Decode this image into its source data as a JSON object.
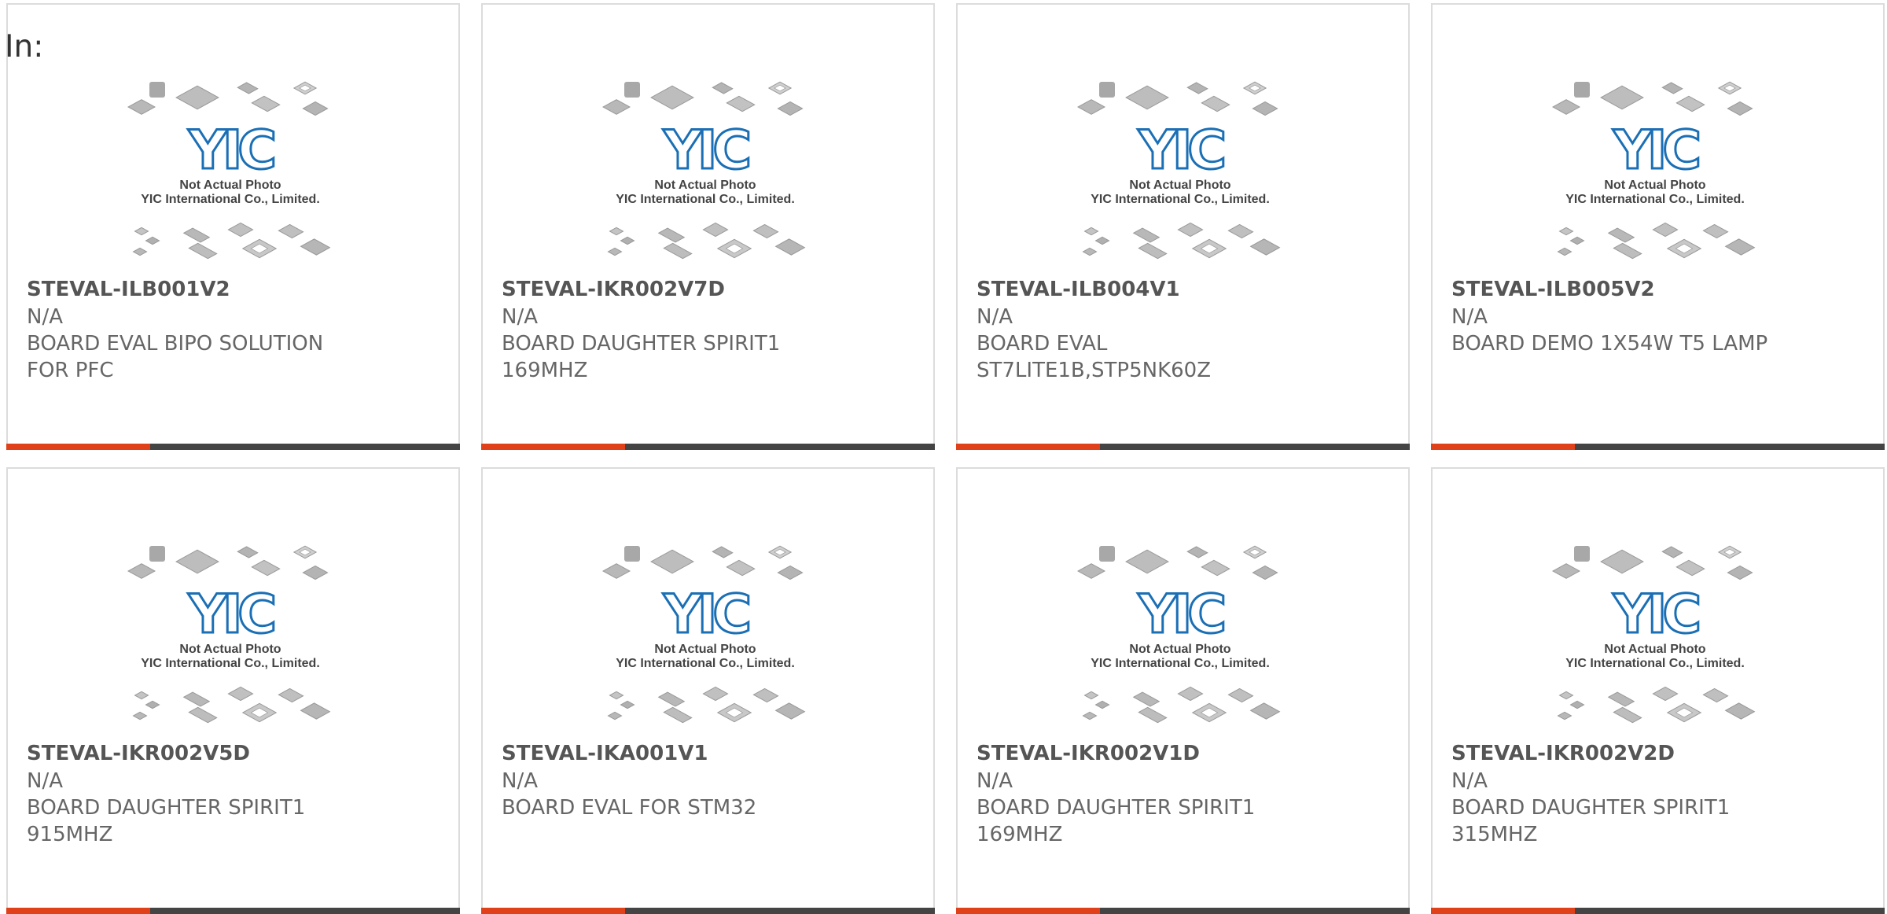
{
  "header": {
    "label": "In:"
  },
  "placeholder_image": {
    "caption_line1": "Not Actual Photo",
    "caption_line2": "YIC International Co., Limited.",
    "logo_text": "YIC",
    "logo_color": "#1a6fb5"
  },
  "colors": {
    "accent": "#e0401a",
    "bar": "#444444",
    "border": "#dcdcdc"
  },
  "products": [
    {
      "part": "STEVAL-ILB001V2",
      "manufacturer": "N/A",
      "description": "BOARD EVAL BIPO SOLUTION FOR PFC"
    },
    {
      "part": "STEVAL-IKR002V7D",
      "manufacturer": "N/A",
      "description": "BOARD DAUGHTER SPIRIT1 169MHZ"
    },
    {
      "part": "STEVAL-ILB004V1",
      "manufacturer": "N/A",
      "description": "BOARD EVAL ST7LITE1B,STP5NK60Z"
    },
    {
      "part": "STEVAL-ILB005V2",
      "manufacturer": "N/A",
      "description": "BOARD DEMO 1X54W T5 LAMP"
    },
    {
      "part": "STEVAL-IKR002V5D",
      "manufacturer": "N/A",
      "description": "BOARD DAUGHTER SPIRIT1 915MHZ"
    },
    {
      "part": "STEVAL-IKA001V1",
      "manufacturer": "N/A",
      "description": "BOARD EVAL FOR STM32"
    },
    {
      "part": "STEVAL-IKR002V1D",
      "manufacturer": "N/A",
      "description": "BOARD DAUGHTER SPIRIT1 169MHZ"
    },
    {
      "part": "STEVAL-IKR002V2D",
      "manufacturer": "N/A",
      "description": "BOARD DAUGHTER SPIRIT1 315MHZ"
    }
  ]
}
